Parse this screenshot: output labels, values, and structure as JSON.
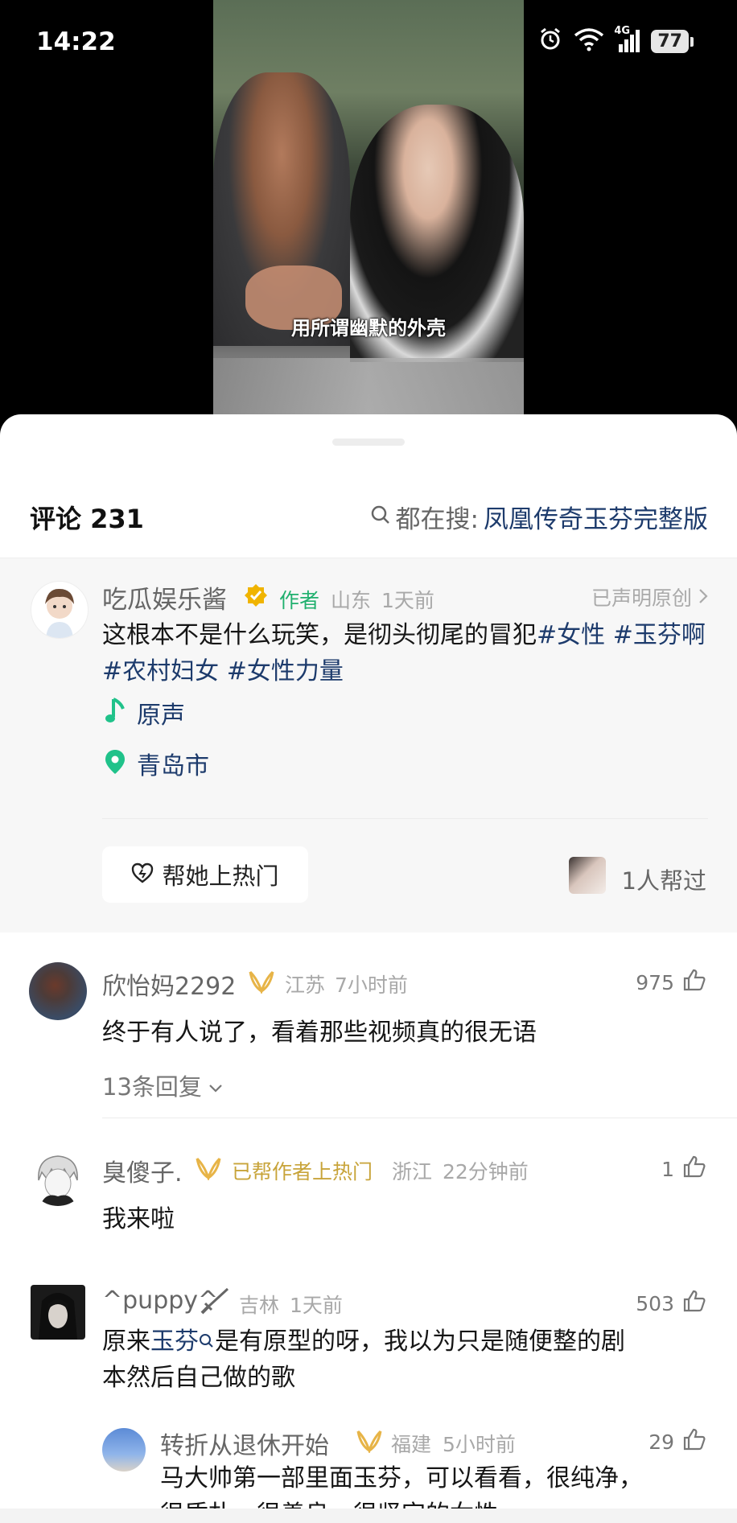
{
  "status_bar": {
    "time": "14:22",
    "network": "4G",
    "battery": "77"
  },
  "video": {
    "subtitle": "用所谓幽默的外壳"
  },
  "header": {
    "title": "评论 231",
    "search_prefix": "都在搜:",
    "search_term": "凤凰传奇玉芬完整版"
  },
  "author_post": {
    "name": "吃瓜娱乐酱",
    "badge": "作者",
    "location": "山东",
    "time": "1天前",
    "original_label": "已声明原创",
    "text_plain": "这根本不是什么玩笑，是彻头彻尾的冒犯",
    "tags": [
      "#女性",
      "#玉芬啊",
      "#农村妇女",
      "#女性力量"
    ],
    "music": "原声",
    "place": "青岛市",
    "promote_button": "帮她上热门",
    "helpers": "1人帮过"
  },
  "comments": [
    {
      "name": "欣怡妈2292",
      "location": "江苏",
      "time": "7小时前",
      "likes": "975",
      "text": "终于有人说了，看着那些视频真的很无语",
      "replies_label": "13条回复"
    },
    {
      "name": "臭傻子.",
      "badge": "已帮作者上热门",
      "location": "浙江",
      "time": "22分钟前",
      "likes": "1",
      "text": "我来啦"
    },
    {
      "name": "^puppy^",
      "location": "吉林",
      "time": "1天前",
      "likes": "503",
      "text_before": "原来",
      "text_link": "玉芬",
      "text_after_line1": "是有原型的呀，我以为只是随便整的剧",
      "text_line2": "本然后自己做的歌"
    },
    {
      "name": "转折从退休开始",
      "location": "福建",
      "time": "5小时前",
      "likes": "29",
      "text_line1": "马大帅第一部里面玉芬，可以看看，很纯净，",
      "text_line2": "很质朴，很善良，很坚定的女性"
    }
  ],
  "colors": {
    "tag_blue": "#1d3b6c",
    "verified_gold": "#f0b400",
    "music_green": "#20c28a",
    "badge_gold": "#c8a43a"
  }
}
